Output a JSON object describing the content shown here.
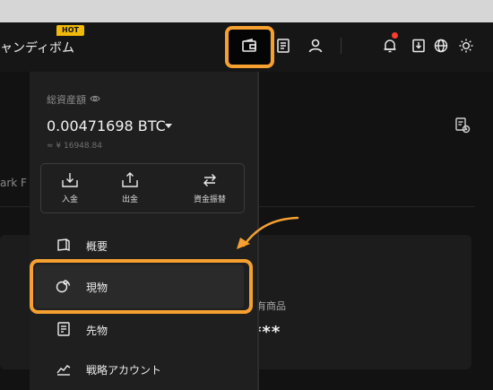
{
  "brand": {
    "title": "ャンディボム",
    "badge": "HOT"
  },
  "nav": {
    "icons": [
      "wallet-icon",
      "orders-icon",
      "user-icon",
      "bell-icon",
      "download-icon",
      "globe-icon",
      "sun-icon"
    ]
  },
  "wallet_menu": {
    "total_label": "総資産額",
    "balance": "0.00471698 BTC",
    "fiat_value": "≈ ¥ 16948.84",
    "actions": [
      {
        "label": "入金",
        "icon": "deposit-icon"
      },
      {
        "label": "出金",
        "icon": "withdraw-icon"
      },
      {
        "label": "資金振替",
        "icon": "transfer-icon"
      }
    ],
    "items": [
      {
        "label": "概要",
        "icon": "overview-icon"
      },
      {
        "label": "現物",
        "icon": "spot-icon",
        "highlighted": true
      },
      {
        "label": "先物",
        "icon": "futures-icon"
      },
      {
        "label": "戦略アカウント",
        "icon": "chart-icon"
      }
    ]
  },
  "background": {
    "partial_tab": "ark F",
    "card_label": "有商品",
    "masked_value": "***"
  },
  "colors": {
    "accent": "#f5a030",
    "hot": "#f0b90b",
    "notification": "#ff3c2e",
    "panel": "#1f1f1f"
  }
}
